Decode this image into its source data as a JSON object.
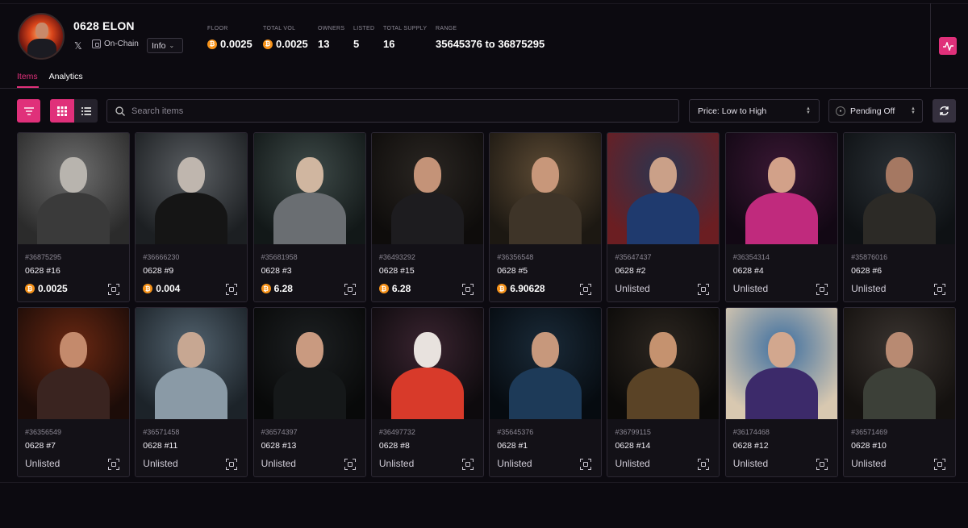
{
  "collection": {
    "name": "0628 ELON",
    "x_label": "𝕏",
    "onchain_label": "On-Chain",
    "info_label": "Info"
  },
  "stats": [
    {
      "label": "FLOOR",
      "value": "0.0025",
      "btc": true
    },
    {
      "label": "TOTAL VOL",
      "value": "0.0025",
      "btc": true
    },
    {
      "label": "OWNERS",
      "value": "13",
      "btc": false
    },
    {
      "label": "LISTED",
      "value": "5",
      "btc": false
    },
    {
      "label": "TOTAL SUPPLY",
      "value": "16",
      "btc": false
    },
    {
      "label": "RANGE",
      "value": "35645376 to 36875295",
      "btc": false
    }
  ],
  "tabs": {
    "items": "Items",
    "analytics": "Analytics"
  },
  "toolbar": {
    "search_placeholder": "Search items",
    "sort_value": "Price: Low to High",
    "pending_value": "Pending Off"
  },
  "colors": {
    "accent": "#e0307a",
    "btc": "#f7931a",
    "bg": "#0c0a10"
  },
  "icons": [
    "search-icon",
    "filter-icon",
    "grid-view-icon",
    "list-view-icon",
    "activity-icon",
    "refresh-icon",
    "scan-icon",
    "bitcoin-icon",
    "x-logo-icon",
    "lock-icon"
  ],
  "items": [
    {
      "inscription": "#36875295",
      "name": "0628 #16",
      "price": "0.0025",
      "listed": true
    },
    {
      "inscription": "#36666230",
      "name": "0628 #9",
      "price": "0.004",
      "listed": true
    },
    {
      "inscription": "#35681958",
      "name": "0628 #3",
      "price": "6.28",
      "listed": true
    },
    {
      "inscription": "#36493292",
      "name": "0628 #15",
      "price": "6.28",
      "listed": true
    },
    {
      "inscription": "#36356548",
      "name": "0628 #5",
      "price": "6.90628",
      "listed": true
    },
    {
      "inscription": "#35647437",
      "name": "0628 #2",
      "price": "Unlisted",
      "listed": false
    },
    {
      "inscription": "#36354314",
      "name": "0628 #4",
      "price": "Unlisted",
      "listed": false
    },
    {
      "inscription": "#35876016",
      "name": "0628 #6",
      "price": "Unlisted",
      "listed": false
    },
    {
      "inscription": "#36356549",
      "name": "0628 #7",
      "price": "Unlisted",
      "listed": false
    },
    {
      "inscription": "#36571458",
      "name": "0628 #11",
      "price": "Unlisted",
      "listed": false
    },
    {
      "inscription": "#36574397",
      "name": "0628 #13",
      "price": "Unlisted",
      "listed": false
    },
    {
      "inscription": "#36497732",
      "name": "0628 #8",
      "price": "Unlisted",
      "listed": false
    },
    {
      "inscription": "#35645376",
      "name": "0628 #1",
      "price": "Unlisted",
      "listed": false
    },
    {
      "inscription": "#36799115",
      "name": "0628 #14",
      "price": "Unlisted",
      "listed": false
    },
    {
      "inscription": "#36174468",
      "name": "0628 #12",
      "price": "Unlisted",
      "listed": false
    },
    {
      "inscription": "#36571469",
      "name": "0628 #10",
      "price": "Unlisted",
      "listed": false
    }
  ]
}
